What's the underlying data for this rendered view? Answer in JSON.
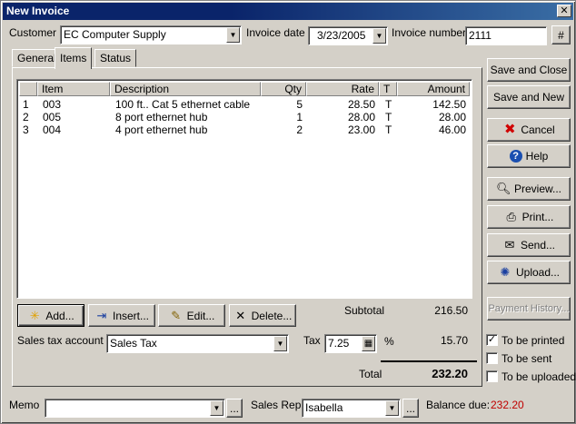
{
  "window": {
    "title": "New Invoice",
    "close_glyph": "✕"
  },
  "header": {
    "customer_label": "Customer",
    "customer_value": "EC Computer Supply",
    "invoice_date_label": "Invoice date",
    "invoice_date_value": "3/23/2005",
    "invoice_number_label": "Invoice number",
    "invoice_number_value": "2111",
    "number_button": "#"
  },
  "tabs": [
    {
      "label": "General",
      "active": false
    },
    {
      "label": "Items",
      "active": true
    },
    {
      "label": "Status",
      "active": false
    }
  ],
  "table": {
    "columns": [
      "",
      "Item",
      "Description",
      "Qty",
      "Rate",
      "T",
      "Amount"
    ],
    "rows": [
      {
        "line": "1",
        "item": "003",
        "description": "100 ft.. Cat 5 ethernet cable",
        "qty": "5",
        "rate": "28.50",
        "t": "T",
        "amount": "142.50"
      },
      {
        "line": "2",
        "item": "005",
        "description": "8 port ethernet hub",
        "qty": "1",
        "rate": "28.00",
        "t": "T",
        "amount": "28.00"
      },
      {
        "line": "3",
        "item": "004",
        "description": "4 port ethernet hub",
        "qty": "2",
        "rate": "23.00",
        "t": "T",
        "amount": "46.00"
      }
    ]
  },
  "item_buttons": {
    "add": "Add...",
    "insert": "Insert...",
    "edit": "Edit...",
    "delete": "Delete..."
  },
  "totals": {
    "subtotal_label": "Subtotal",
    "subtotal_value": "216.50",
    "sales_tax_account_label": "Sales tax account",
    "sales_tax_account_value": "Sales Tax",
    "tax_label": "Tax",
    "tax_rate": "7.25",
    "percent": "%",
    "tax_value": "15.70",
    "total_label": "Total",
    "total_value": "232.20"
  },
  "footer": {
    "memo_label": "Memo",
    "memo_value": "",
    "sales_rep_label": "Sales Rep.",
    "sales_rep_value": "Isabella",
    "balance_due_label": "Balance due:",
    "balance_due_value": "232.20",
    "ellipsis": "..."
  },
  "side_buttons": {
    "save_close": "Save and Close",
    "save_new": "Save and New",
    "cancel": "Cancel",
    "help": "Help",
    "preview": "Preview...",
    "print": "Print...",
    "send": "Send...",
    "upload": "Upload...",
    "payment_history": "Payment History..."
  },
  "options": [
    {
      "label": "To be printed",
      "checked": true
    },
    {
      "label": "To be sent",
      "checked": false
    },
    {
      "label": "To be uploaded",
      "checked": false
    }
  ],
  "colors": {
    "title_bar": "#0a246a",
    "balance_due": "#c00000",
    "window_bg": "#d4d0c8"
  },
  "icons": {
    "dropdown": "chevron-down-icon",
    "cancel": "red-x-icon",
    "help": "help-icon",
    "preview": "magnifier-icon",
    "print": "printer-icon",
    "send": "envelope-icon",
    "upload": "upload-icon",
    "add": "sparkle-icon",
    "insert": "insert-icon",
    "edit": "pencil-icon",
    "delete": "x-icon",
    "calculator": "calculator-icon"
  }
}
